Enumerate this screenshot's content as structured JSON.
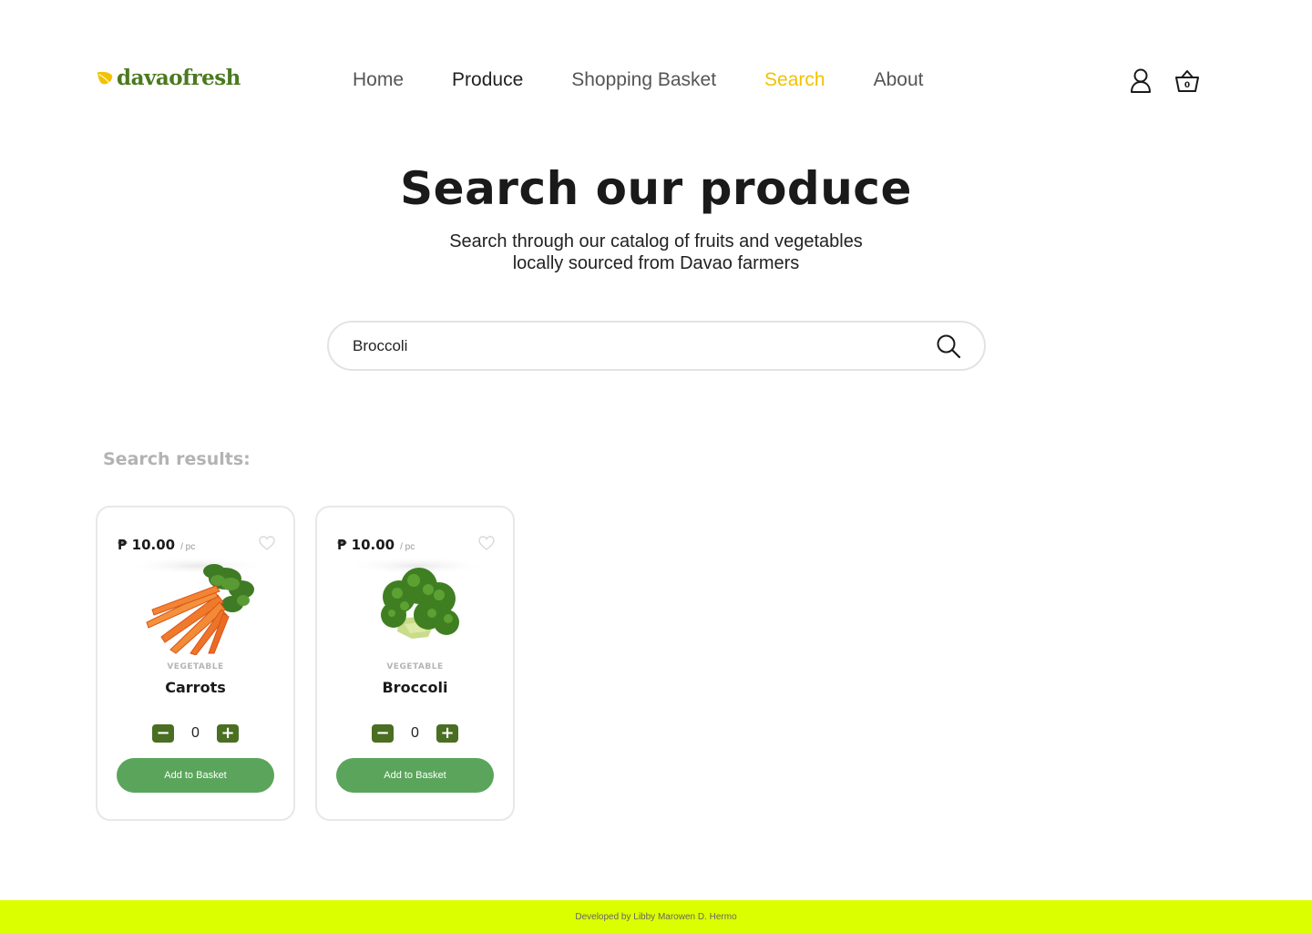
{
  "brand": {
    "name": "davaofresh",
    "logo_color": "#4a7a1e",
    "leaf_color": "#f2c200"
  },
  "nav": {
    "items": [
      {
        "label": "Home",
        "active": false
      },
      {
        "label": "Produce",
        "active": false
      },
      {
        "label": "Shopping Basket",
        "active": false
      },
      {
        "label": "Search",
        "active": true
      },
      {
        "label": "About",
        "active": false
      }
    ],
    "active_color": "#f2c200",
    "icons": [
      "user-icon",
      "basket-icon"
    ],
    "basket_count": "0"
  },
  "hero": {
    "title": "Search our produce",
    "subtitle_line1": "Search through our catalog of fruits and vegetables",
    "subtitle_line2": "locally sourced from Davao farmers"
  },
  "search": {
    "value": "Broccoli",
    "icon": "search-icon"
  },
  "results": {
    "label": "Search results:",
    "products": [
      {
        "currency": "₱",
        "price": "10.00",
        "unit": "/ pc",
        "category": "VEGETABLE",
        "name": "Carrots",
        "quantity": "0",
        "button": "Add to Basket",
        "image": "carrots-image"
      },
      {
        "currency": "₱",
        "price": "10.00",
        "unit": "/ pc",
        "category": "VEGETABLE",
        "name": "Broccoli",
        "quantity": "0",
        "button": "Add to Basket",
        "image": "broccoli-image"
      }
    ]
  },
  "footer": {
    "text": "Developed by Libby Marowen D. Hermo",
    "color": "#dcff00"
  },
  "colors": {
    "button_green": "#5aa55b",
    "stepper_green": "#4a6e22"
  }
}
